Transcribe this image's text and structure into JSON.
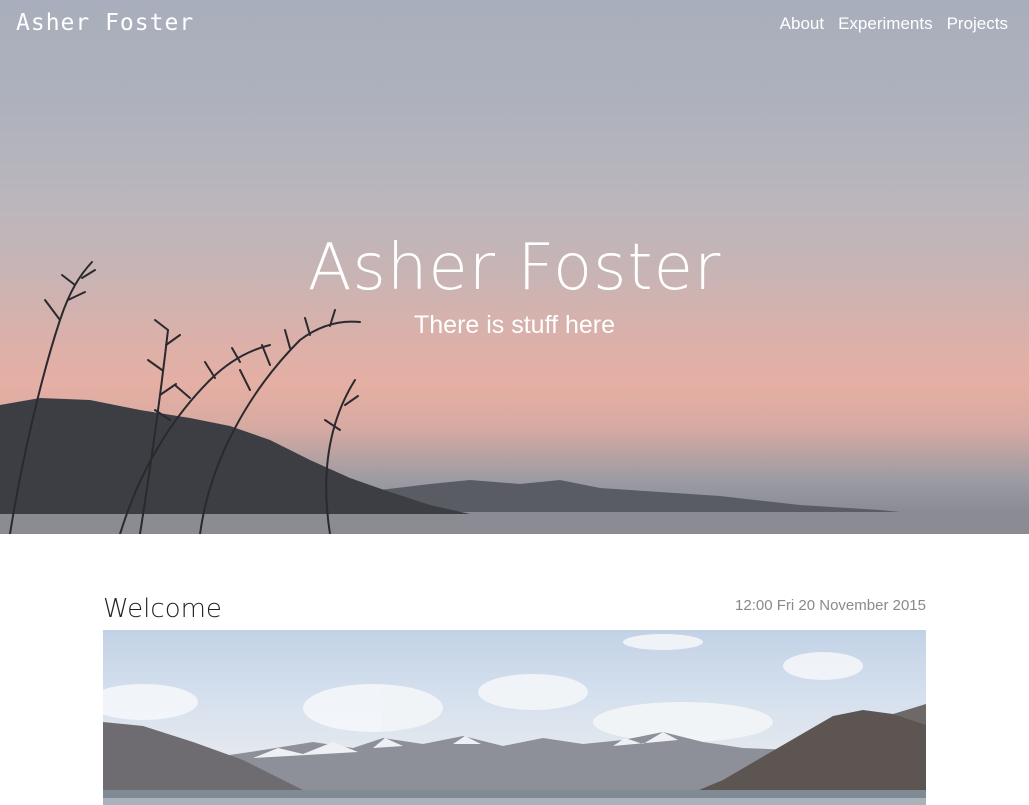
{
  "header": {
    "logo": "Asher Foster",
    "nav": [
      {
        "label": "About"
      },
      {
        "label": "Experiments"
      },
      {
        "label": "Projects"
      }
    ]
  },
  "hero": {
    "title": "Asher Foster",
    "subtitle": "There is stuff here"
  },
  "post": {
    "title": "Welcome",
    "date": "12:00 Fri 20 November 2015"
  }
}
